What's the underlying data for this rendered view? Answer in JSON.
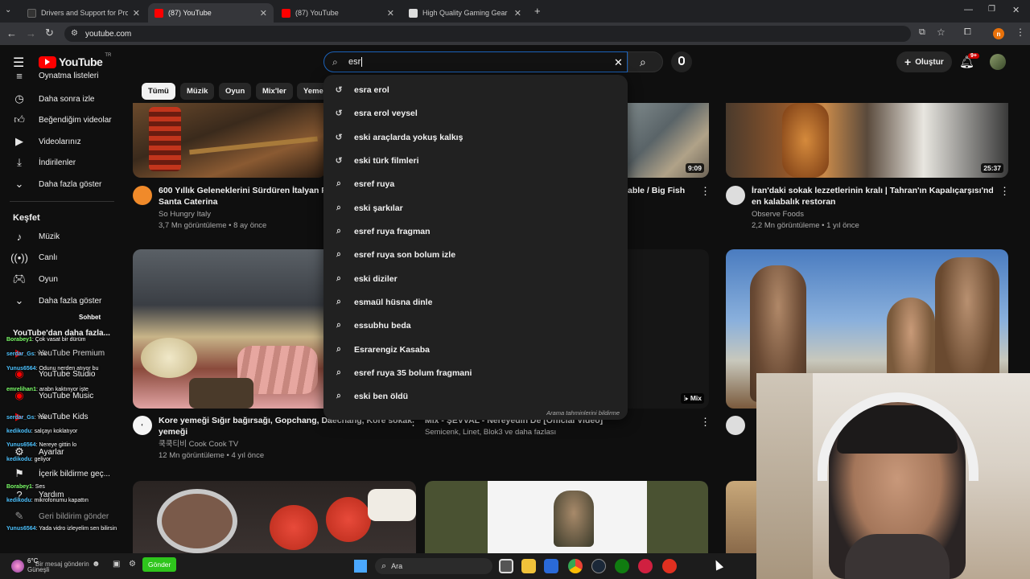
{
  "browser": {
    "tabs": [
      {
        "title": "Drivers and Support for Process",
        "active": false,
        "favicon_color": "#333333"
      },
      {
        "title": "(87) YouTube",
        "active": true,
        "favicon_color": "#ff0000"
      },
      {
        "title": "(87) YouTube",
        "active": false,
        "favicon_color": "#ff0000"
      },
      {
        "title": "High Quality Gaming Gear – Hy",
        "active": false,
        "favicon_color": "#dddddd"
      }
    ],
    "url": "youtube.com",
    "profile_initial": "n"
  },
  "youtube": {
    "logo_text": "YouTube",
    "logo_region": "TR",
    "search": {
      "value": "esr"
    },
    "create_label": "Oluştur",
    "notification_count": "9+",
    "chips": [
      {
        "label": "Tümü",
        "selected": true
      },
      {
        "label": "Müzik",
        "selected": false
      },
      {
        "label": "Oyun",
        "selected": false
      },
      {
        "label": "Mix'ler",
        "selected": false
      },
      {
        "label": "Yeme",
        "selected": false
      }
    ],
    "sidebar": {
      "items": [
        {
          "label": "Oynatma listeleri",
          "icon": "playlist-icon"
        },
        {
          "label": "Daha sonra izle",
          "icon": "clock-icon"
        },
        {
          "label": "Beğendiğim videolar",
          "icon": "thumbs-up-icon"
        },
        {
          "label": "Videolarınız",
          "icon": "video-icon"
        },
        {
          "label": "İndirilenler",
          "icon": "download-icon"
        },
        {
          "label": "Daha fazla göster",
          "icon": "chevron-down-icon"
        }
      ],
      "explore_title": "Keşfet",
      "explore_items": [
        {
          "label": "Müzik",
          "icon": "music-icon"
        },
        {
          "label": "Canlı",
          "icon": "live-icon"
        },
        {
          "label": "Oyun",
          "icon": "gamepad-icon"
        },
        {
          "label": "Daha fazla göster",
          "icon": "chevron-down-icon"
        }
      ],
      "more_title": "YouTube'dan daha fazla...",
      "more_items": [
        {
          "label": "YouTube Premium"
        },
        {
          "label": "YouTube Studio"
        },
        {
          "label": "YouTube Music"
        },
        {
          "label": "YouTube Kids"
        }
      ],
      "bottom_items": [
        {
          "label": "Ayarlar",
          "icon": "gear-icon"
        },
        {
          "label": "İçerik bildirme geç...",
          "icon": "flag-icon"
        },
        {
          "label": "Yardım",
          "icon": "help-icon"
        },
        {
          "label": "Geri bildirim gönder",
          "icon": "feedback-icon"
        }
      ]
    },
    "suggestions": [
      {
        "text": "esra erol",
        "type": "history"
      },
      {
        "text": "esra erol veysel",
        "type": "history"
      },
      {
        "text": "eski araçlarda yokuş kalkış",
        "type": "history"
      },
      {
        "text": "eski türk filmleri",
        "type": "history"
      },
      {
        "text": "esref ruya",
        "type": "search"
      },
      {
        "text": "eski şarkılar",
        "type": "search"
      },
      {
        "text": "esref ruya fragman",
        "type": "search"
      },
      {
        "text": "esref ruya son bolum izle",
        "type": "search"
      },
      {
        "text": "eski diziler",
        "type": "search"
      },
      {
        "text": "esmaül hüsna dinle",
        "type": "search"
      },
      {
        "text": "essubhu beda",
        "type": "search"
      },
      {
        "text": "Esrarengiz Kasaba",
        "type": "search"
      },
      {
        "text": "esref ruya 35 bolum fragmani",
        "type": "search"
      },
      {
        "text": "eski ben öldü",
        "type": "search"
      }
    ],
    "suggest_footer": "Arama tahminlerini bildirme",
    "videos": [
      {
        "title_l1": "600 Yıllık Geleneklerini Sürdüren İtalyan Fır",
        "title_l2": "Santa Caterina",
        "channel": "So Hungry Italy",
        "meta": "3,7 Mn görüntüleme • 8 ay önce",
        "avatar_color": "#f08a2a"
      },
      {
        "title_l1": "able / Big Fish",
        "title_l2": "",
        "channel": "",
        "meta": "",
        "duration": "9:09",
        "avatar_color": "#444444"
      },
      {
        "title_l1": "İran'daki sokak lezzetlerinin kralı | Tahran'ın Kapalıçarşısı'ndaki",
        "title_l2": "en kalabalık restoran",
        "channel": "Observe Foods",
        "meta": "2,2 Mn görüntüleme • 1 yıl önce",
        "duration": "25:37",
        "avatar_color": "#dddddd"
      },
      {
        "title_l1": "Kore yemeği Sığır bağırsağı, Gopchang, Daechang, Kore sokak",
        "title_l2": "yemeği",
        "channel": "쿡쿡티비 Cook Cook TV",
        "meta": "12 Mn görüntüleme • 4 yıl önce",
        "avatar_color": "#f5f5f5"
      },
      {
        "title_l1": "Mix - ŞEVVAL - Nereyedin De [Official Video]",
        "title_l2": "",
        "channel": "Semicenk, Linet, Blok3 ve daha fazlası",
        "meta": "",
        "mix_label": "Mix"
      }
    ]
  },
  "chat": {
    "title": "Sohbet",
    "lines": [
      {
        "user": "Borabey1",
        "text": ": Çok vasat bir dürüm"
      },
      {
        "user": "serdar_Gs",
        "text": ": Yok"
      },
      {
        "user": "Yunus6564",
        "text": ": Odunu nerden atıyor bu"
      },
      {
        "user": "emrelihan1",
        "text": ": arabn kaktınyor işte"
      },
      {
        "user": "serdar_Gs",
        "text": ": Yok"
      },
      {
        "user": "kedikodu",
        "text": ": salçayı koklatıyor"
      },
      {
        "user": "Yunus6564",
        "text": ": Nereye gittin lo"
      },
      {
        "user": "kedikodu",
        "text": ": geliyor"
      },
      {
        "user": "Borabey1",
        "text": ": Ses"
      },
      {
        "user": "kedikodu",
        "text": ": mikrofonumu kapattın"
      },
      {
        "user": "Yunus6564",
        "text": ": Yada vidro izleyelim sen bilirsin"
      }
    ],
    "input_placeholder": "Bir mesaj gönderin",
    "send_label": "Gönder"
  },
  "taskbar": {
    "weather_temp": "6°C",
    "weather_text": "Güneşli",
    "search_label": "Ara"
  }
}
